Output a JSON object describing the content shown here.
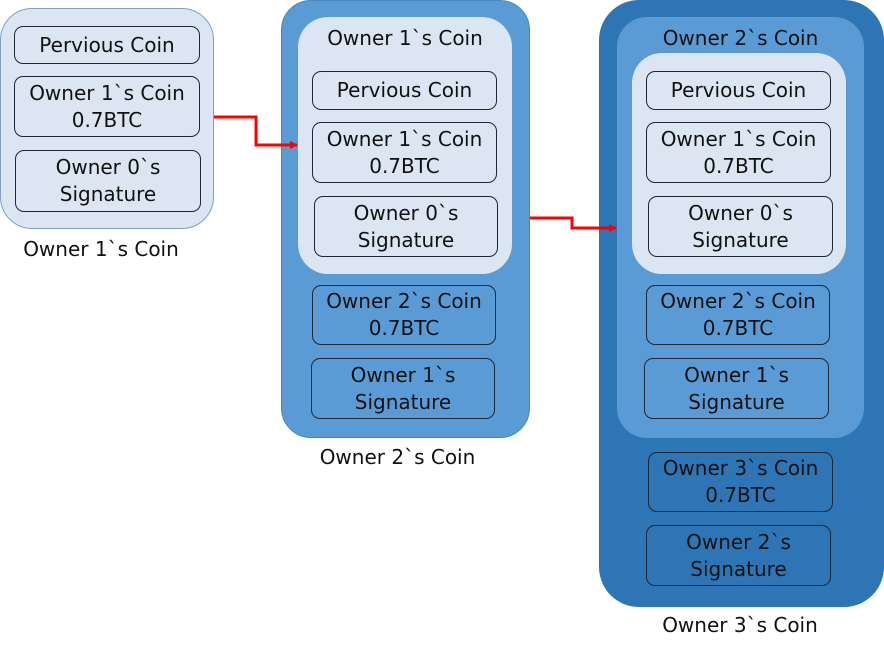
{
  "coins": [
    {
      "label": "Owner 1`s Coin",
      "boxes": [
        {
          "l1": "Pervious Coin"
        },
        {
          "l1": "Owner 1`s Coin",
          "l2": "0.7BTC"
        },
        {
          "l1": "Owner 0`s",
          "l2": "Signature"
        }
      ]
    },
    {
      "label": "Owner 2`s Coin",
      "inner_title": "Owner 1`s Coin",
      "inner_boxes": [
        {
          "l1": "Pervious Coin"
        },
        {
          "l1": "Owner 1`s Coin",
          "l2": "0.7BTC"
        },
        {
          "l1": "Owner 0`s",
          "l2": "Signature"
        }
      ],
      "boxes": [
        {
          "l1": "Owner 2`s Coin",
          "l2": "0.7BTC"
        },
        {
          "l1": "Owner 1`s",
          "l2": "Signature"
        }
      ]
    },
    {
      "label": "Owner 3`s Coin",
      "mid_title": "Owner 2`s Coin",
      "inner_boxes": [
        {
          "l1": "Pervious Coin"
        },
        {
          "l1": "Owner 1`s Coin",
          "l2": "0.7BTC"
        },
        {
          "l1": "Owner 0`s",
          "l2": "Signature"
        }
      ],
      "mid_boxes": [
        {
          "l1": "Owner 2`s Coin",
          "l2": "0.7BTC"
        },
        {
          "l1": "Owner 1`s",
          "l2": "Signature"
        }
      ],
      "boxes": [
        {
          "l1": "Owner 3`s Coin",
          "l2": "0.7BTC"
        },
        {
          "l1": "Owner 2`s",
          "l2": "Signature"
        }
      ]
    }
  ],
  "colors": {
    "light": "#dce6f2",
    "medium": "#5b9bd5",
    "dark": "#2e75b6",
    "arrow": "#ff0000"
  }
}
